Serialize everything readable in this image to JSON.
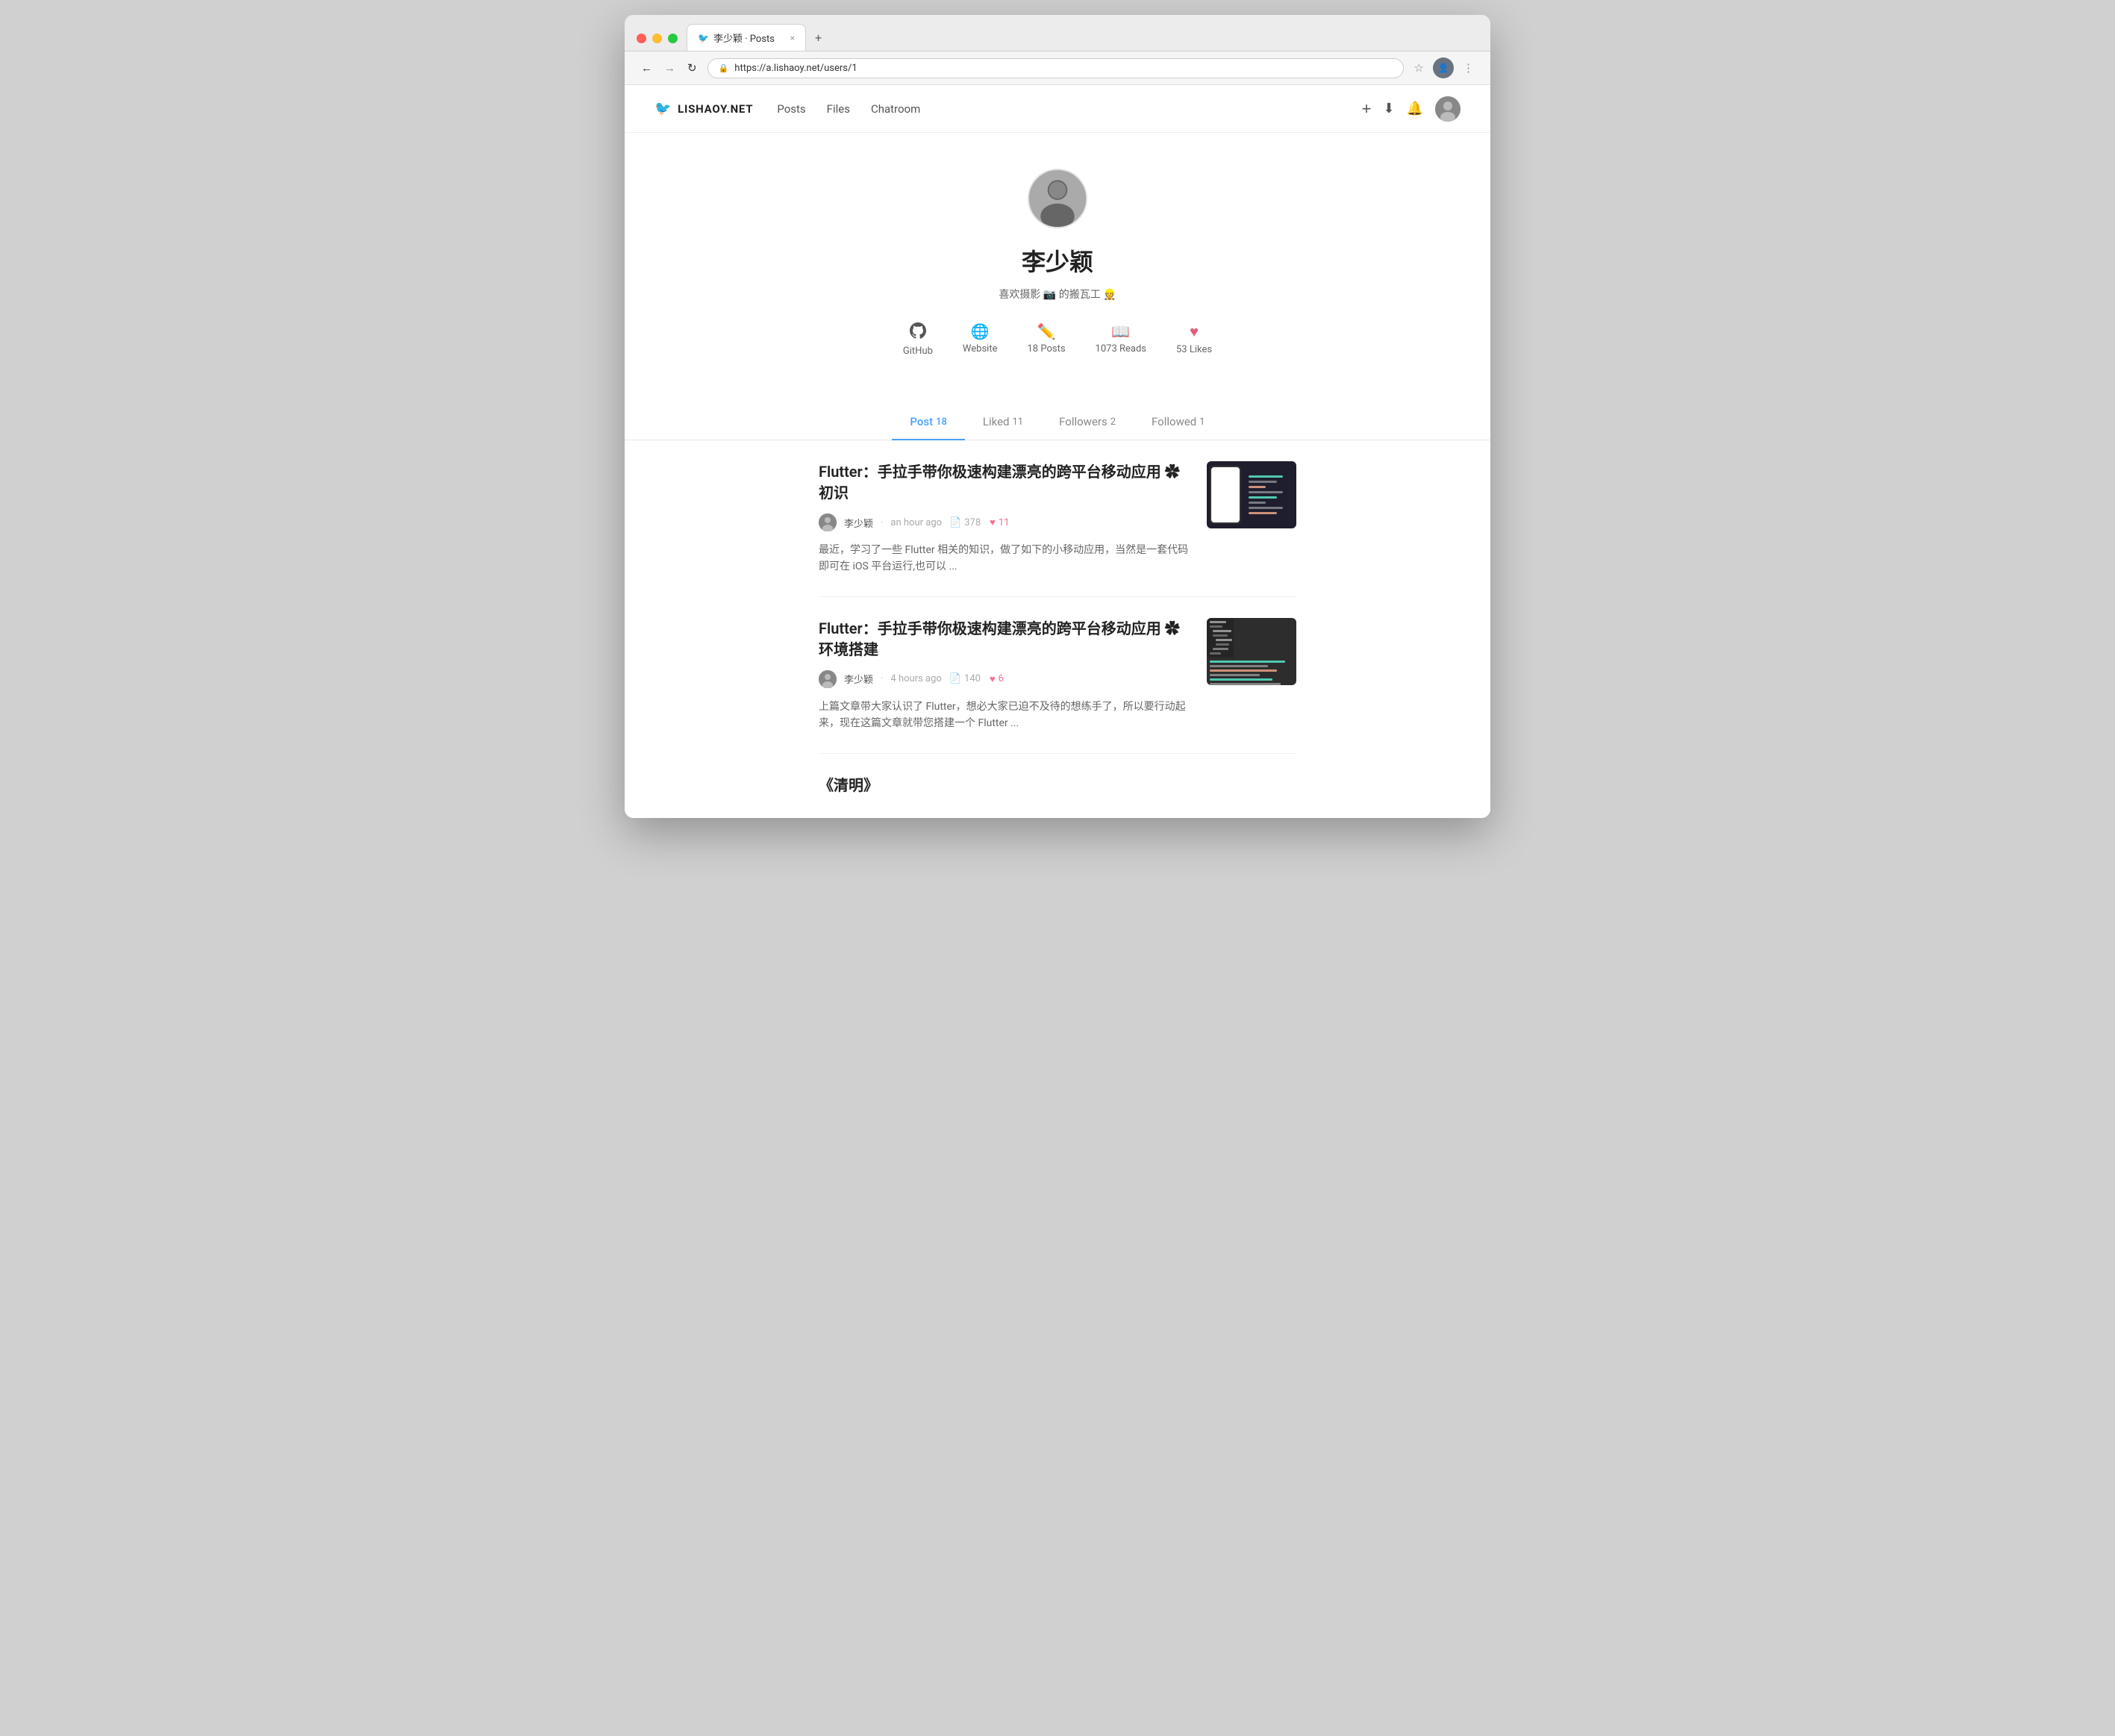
{
  "browser": {
    "tab_icon": "🐦",
    "tab_title": "李少颖 · Posts",
    "tab_close": "×",
    "tab_new": "+",
    "back_btn": "←",
    "forward_btn": "→",
    "reload_btn": "↻",
    "url": "https://a.lishaoy.net/users/1",
    "bookmark_icon": "☆",
    "menu_icon": "⋮"
  },
  "site": {
    "logo_icon": "🐦",
    "logo_text": "LISHAOY.NET",
    "nav": [
      {
        "label": "Posts",
        "href": "#"
      },
      {
        "label": "Files",
        "href": "#"
      },
      {
        "label": "Chatroom",
        "href": "#"
      }
    ],
    "actions": {
      "add": "+",
      "download": "⬇",
      "notification": "🔔"
    }
  },
  "profile": {
    "name": "李少颖",
    "bio": "喜欢摄影 📷 的搬瓦工 👷",
    "stats": [
      {
        "icon": "⊙",
        "label": "GitHub"
      },
      {
        "icon": "🌐",
        "label": "Website"
      },
      {
        "icon": "✏️",
        "label": "18 Posts"
      },
      {
        "icon": "📖",
        "label": "1073 Reads"
      },
      {
        "icon": "♥",
        "label": "53 Likes"
      }
    ]
  },
  "tabs": [
    {
      "label": "Post",
      "count": "18",
      "active": true
    },
    {
      "label": "Liked",
      "count": "11",
      "active": false
    },
    {
      "label": "Followers",
      "count": "2",
      "active": false
    },
    {
      "label": "Followed",
      "count": "1",
      "active": false
    }
  ],
  "posts": [
    {
      "title": "Flutter：手拉手带你极速构建漂亮的跨平台移动应用 ✿ 初识",
      "author": "李少颖",
      "time": "an hour ago",
      "reads": "378",
      "likes": "11",
      "excerpt": "最近，学习了一些 Flutter 相关的知识，做了如下的小移动应用，当然是一套代码即可在 iOS 平台运行,也可以 ...",
      "has_thumbnail": true,
      "thumb_type": "1"
    },
    {
      "title": "Flutter：手拉手带你极速构建漂亮的跨平台移动应用 ✿ 环境搭建",
      "author": "李少颖",
      "time": "4 hours ago",
      "reads": "140",
      "likes": "6",
      "excerpt": "上篇文章带大家认识了 Flutter，想必大家已迫不及待的想练手了，所以要行动起来，现在这篇文章就带您搭建一个 Flutter ...",
      "has_thumbnail": true,
      "thumb_type": "2"
    },
    {
      "title": "《清明》",
      "author": "",
      "time": "",
      "reads": "",
      "likes": "",
      "excerpt": "",
      "has_thumbnail": false,
      "thumb_type": ""
    }
  ]
}
